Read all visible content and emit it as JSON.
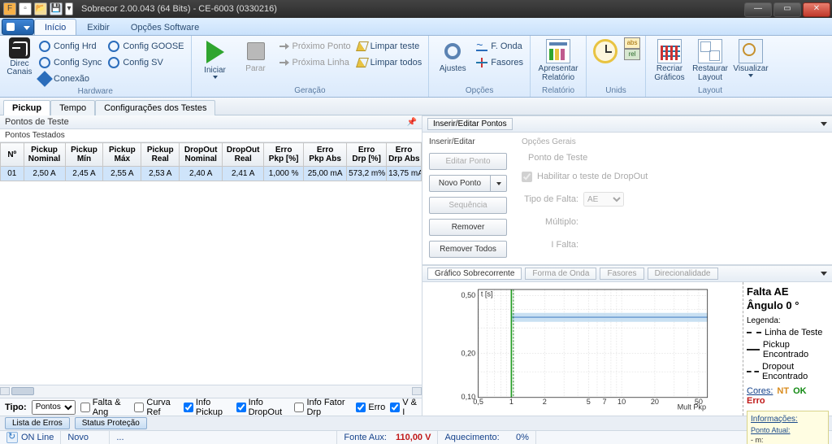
{
  "title": "Sobrecor 2.00.043 (64 Bits) - CE-6003 (0330216)",
  "menu": {
    "inicio": "Início",
    "exibir": "Exibir",
    "opcoes": "Opções Software"
  },
  "ribbon": {
    "hardware": {
      "label": "Hardware",
      "direc": "Direc\nCanais",
      "cfg_hrd": "Config Hrd",
      "cfg_goose": "Config GOOSE",
      "cfg_sync": "Config Sync",
      "cfg_sv": "Config SV",
      "conexao": "Conexão"
    },
    "geracao": {
      "label": "Geração",
      "iniciar": "Iniciar",
      "parar": "Parar",
      "prox_ponto": "Próximo Ponto",
      "prox_linha": "Próxima Linha",
      "limpar_teste": "Limpar teste",
      "limpar_todos": "Limpar todos"
    },
    "opcoes": {
      "label": "Opções",
      "ajustes": "Ajustes",
      "f_onda": "F. Onda",
      "fasores": "Fasores"
    },
    "relatorio": {
      "label": "Relatório",
      "apresentar": "Apresentar\nRelatório"
    },
    "unids": {
      "label": "Unids",
      "abs": "abs",
      "rel": "rel"
    },
    "layout": {
      "label": "Layout",
      "recriar": "Recriar\nGráficos",
      "restaurar": "Restaurar\nLayout",
      "visualizar": "Visualizar"
    }
  },
  "doc_tabs": {
    "pickup": "Pickup",
    "tempo": "Tempo",
    "config": "Configurações dos Testes"
  },
  "left_panel": {
    "head": "Pontos de Teste",
    "sub": "Pontos Testados"
  },
  "table": {
    "cols": [
      "Nº",
      "Pickup Nominal",
      "Pickup Mín",
      "Pickup Máx",
      "Pickup Real",
      "DropOut Nominal",
      "DropOut Real",
      "Erro Pkp [%]",
      "Erro Pkp Abs",
      "Erro Drp [%]",
      "Erro Drp Abs"
    ],
    "rows": [
      [
        "01",
        "2,50 A",
        "2,45 A",
        "2,55 A",
        "2,53 A",
        "2,40 A",
        "2,41 A",
        "1,000 %",
        "25,00 mA",
        "573,2 m%",
        "13,75 mA"
      ]
    ]
  },
  "tipo": {
    "label": "Tipo:",
    "value": "Pontos",
    "opts": [
      "Pontos"
    ],
    "chk_falta": "Falta & Ang",
    "chk_curva": "Curva Ref",
    "chk_info_pkp": "Info Pickup",
    "chk_info_drp": "Info DropOut",
    "chk_info_fdrp": "Info Fator Drp",
    "chk_erro": "Erro",
    "chk_vi": "V & I"
  },
  "edit": {
    "title": "Inserir/Editar Pontos",
    "col1": "Inserir/Editar",
    "editar": "Editar Ponto",
    "novo": "Novo Ponto",
    "seq": "Sequência",
    "remover": "Remover",
    "remover_todos": "Remover Todos",
    "col2": "Opções Gerais",
    "ponto_teste": "Ponto de Teste",
    "hab_dropout": "Habilitar o teste de DropOut",
    "tipo_falta": "Tipo de Falta:",
    "tipo_falta_val": "AE",
    "multiplo": "Múltiplo:",
    "ifalta": "I Falta:"
  },
  "chart_tabs": {
    "sobre": "Gráfico Sobrecorrente",
    "forma": "Forma de Onda",
    "fasores": "Fasores",
    "direc": "Direcionalidade"
  },
  "chart_side": {
    "falta": "Falta AE",
    "angulo": "Ângulo 0 °",
    "legenda": "Legenda:",
    "l1": "Linha de Teste",
    "l2": "Pickup Encontrado",
    "l3": "Dropout Encontrado",
    "cores": "Cores:",
    "nt": "NT",
    "ok": "OK",
    "erro": "Erro",
    "info": "Informações:",
    "ponto": "Ponto Atual:",
    "mval": "- m:"
  },
  "chart_data": {
    "type": "line",
    "xlabel": "Mult Pkp",
    "ylabel": "t [s]",
    "xscale": "log",
    "xlim": [
      0.5,
      60
    ],
    "ylim": [
      0.1,
      0.55
    ],
    "xticks": [
      0.5,
      1.0,
      2.0,
      5.0,
      7.0,
      10,
      20,
      50
    ],
    "yticks": [
      0.1,
      0.2,
      0.5
    ],
    "test_line_x": 1.0,
    "pickup_band": {
      "xmin": 1.0,
      "xmax": 60,
      "ymin": 0.33,
      "ymax": 0.38
    }
  },
  "btm": {
    "lista_erros": "Lista de Erros",
    "status_prot": "Status Proteção"
  },
  "status": {
    "online": "ON Line",
    "novo": "Novo",
    "dots": "...",
    "fonte_aux": "Fonte Aux:",
    "fonte_v": "110,00 V",
    "aquec": "Aquecimento:",
    "aquec_v": "0%"
  }
}
